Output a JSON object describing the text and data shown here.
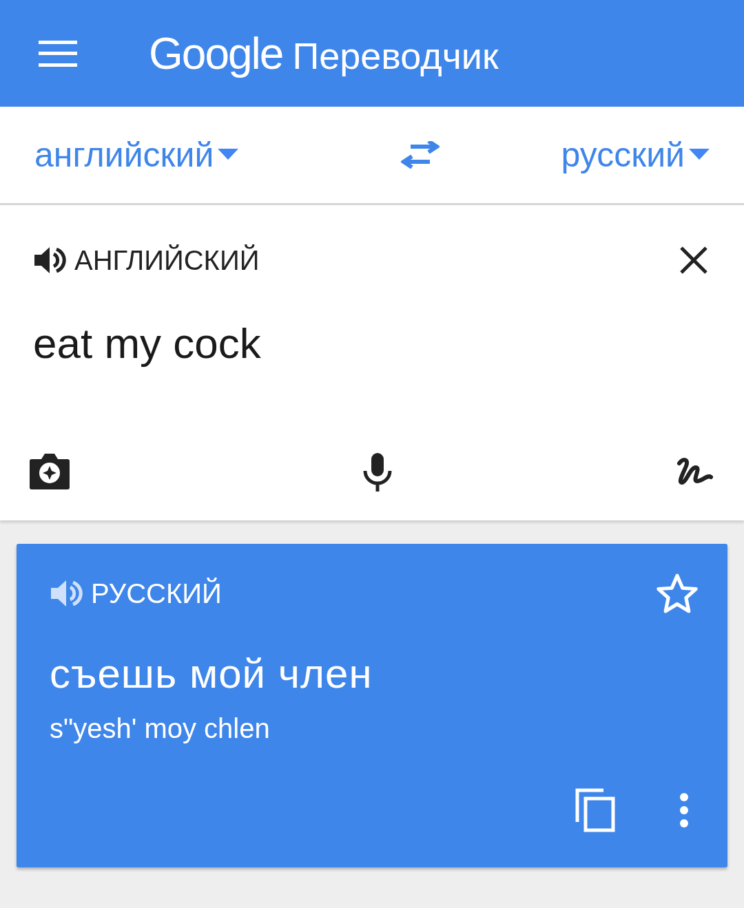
{
  "header": {
    "logo": "Google",
    "title": "Переводчик"
  },
  "language_bar": {
    "source": "английский",
    "target": "русский"
  },
  "input": {
    "language_label": "АНГЛИЙСКИЙ",
    "text": "eat my cock"
  },
  "result": {
    "language_label": "РУССКИЙ",
    "translation": "съешь мой член",
    "transliteration": "s\"yesh' moy chlen",
    "starred": false
  }
}
